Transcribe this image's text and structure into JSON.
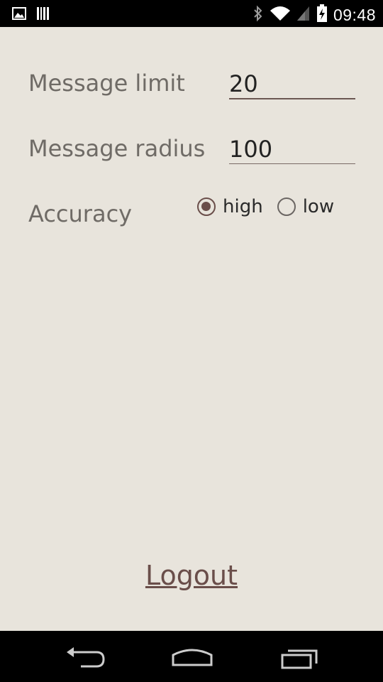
{
  "status_bar": {
    "left_icons": [
      "image-icon",
      "barcode-icon"
    ],
    "right_icons": [
      "bluetooth-icon",
      "wifi-icon",
      "cell-signal-icon",
      "battery-charging-icon"
    ],
    "time": "09:48"
  },
  "settings": {
    "message_limit": {
      "label": "Message limit",
      "value": "20"
    },
    "message_radius": {
      "label": "Message radius",
      "value": "100"
    },
    "accuracy": {
      "label": "Accuracy",
      "options": [
        {
          "label": "high",
          "selected": true
        },
        {
          "label": "low",
          "selected": false
        }
      ]
    }
  },
  "logout_label": "Logout",
  "nav": [
    "back-icon",
    "home-icon",
    "recent-apps-icon"
  ],
  "colors": {
    "background": "#e8e4dc",
    "accent": "#6a4e4a",
    "label": "#6f6b66"
  }
}
